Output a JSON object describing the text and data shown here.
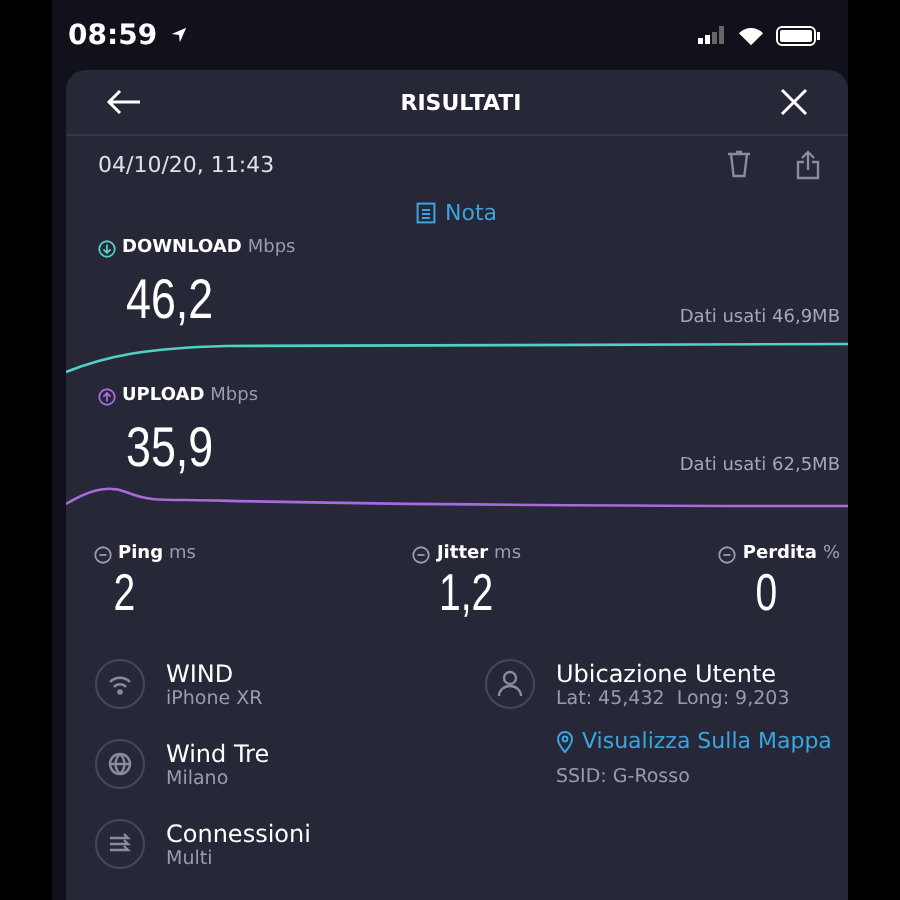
{
  "status_bar": {
    "time": "08:59"
  },
  "header": {
    "title": "RISULTATI"
  },
  "date": "04/10/20, 11:43",
  "note_link": "Nota",
  "speeds": [
    {
      "kind": "download",
      "label": "DOWNLOAD",
      "unit": "Mbps",
      "value": "46,2",
      "data_used": "Dati usati 46,9MB",
      "color": "#4fd1c5"
    },
    {
      "kind": "upload",
      "label": "UPLOAD",
      "unit": "Mbps",
      "value": "35,9",
      "data_used": "Dati usati 62,5MB",
      "color": "#a66be0"
    }
  ],
  "metrics": [
    {
      "label": "Ping",
      "unit": "ms",
      "value": "2"
    },
    {
      "label": "Jitter",
      "unit": "ms",
      "value": "1,2"
    },
    {
      "label": "Perdita",
      "unit": "%",
      "value": "0"
    }
  ],
  "connection": [
    {
      "kind": "wifi",
      "title": "WIND",
      "subtitle": "iPhone XR"
    },
    {
      "kind": "globe",
      "title": "Wind Tre",
      "subtitle": "Milano"
    },
    {
      "kind": "connections",
      "title": "Connessioni",
      "subtitle": "Multi"
    }
  ],
  "location": {
    "title": "Ubicazione Utente",
    "coordinates": "Lat: 45,432  Long: 9,203",
    "map_link": "Visualizza Sulla Mappa",
    "ssid": "SSID: G-Rosso"
  }
}
